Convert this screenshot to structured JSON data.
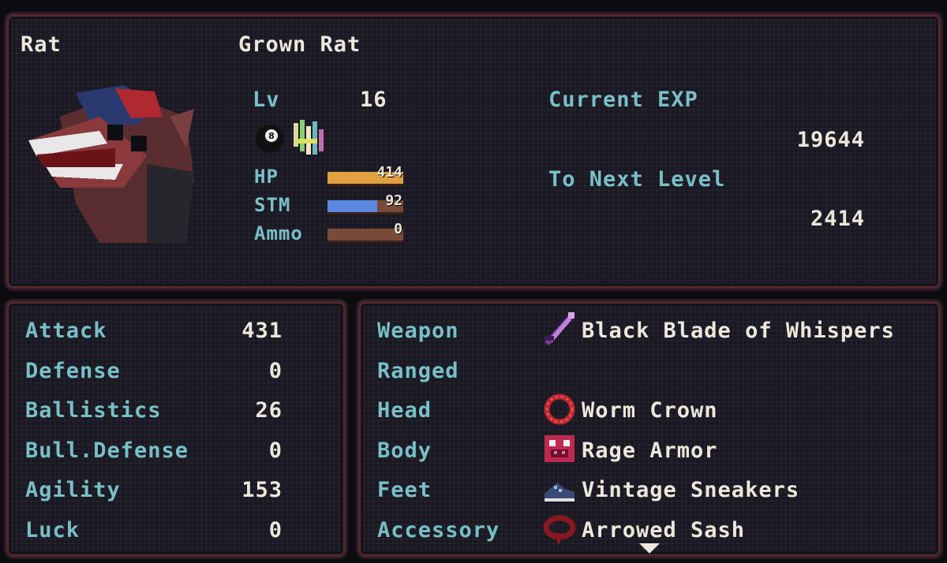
{
  "header": {
    "species": "Rat",
    "name": "Grown Rat",
    "level_label": "Lv",
    "level_value": "16",
    "status_icons": [
      "eight-ball-icon",
      "glitch-icon"
    ],
    "current_exp_label": "Current EXP",
    "current_exp_value": "19644",
    "next_level_label": "To Next Level",
    "next_level_value": "2414"
  },
  "bars": {
    "hp": {
      "label": "HP",
      "value": "414",
      "fill_fraction": 1.0,
      "color": "#e0a040"
    },
    "stm": {
      "label": "STM",
      "value": "92",
      "fill_fraction": 0.66,
      "color": "#5a88e0"
    },
    "ammo": {
      "label": "Ammo",
      "value": "0",
      "fill_fraction": 0.0,
      "color": "#7a4a38"
    }
  },
  "stats": [
    {
      "label": "Attack",
      "value": "431"
    },
    {
      "label": "Defense",
      "value": "0"
    },
    {
      "label": "Ballistics",
      "value": "26"
    },
    {
      "label": "Bull.Defense",
      "value": "0"
    },
    {
      "label": "Agility",
      "value": "153"
    },
    {
      "label": "Luck",
      "value": "0"
    }
  ],
  "equipment": [
    {
      "slot": "Weapon",
      "item": "Black Blade of Whispers",
      "icon": "blade-icon"
    },
    {
      "slot": "Ranged",
      "item": "",
      "icon": ""
    },
    {
      "slot": "Head",
      "item": "Worm Crown",
      "icon": "worm-crown-icon"
    },
    {
      "slot": "Body",
      "item": "Rage Armor",
      "icon": "armor-icon"
    },
    {
      "slot": "Feet",
      "item": "Vintage Sneakers",
      "icon": "sneaker-icon"
    },
    {
      "slot": "Accessory",
      "item": "Arrowed Sash",
      "icon": "sash-icon"
    }
  ],
  "colors": {
    "label_cyan": "#78c0c8",
    "text_white": "#ece8dc",
    "panel_border": "#5a2a32"
  }
}
